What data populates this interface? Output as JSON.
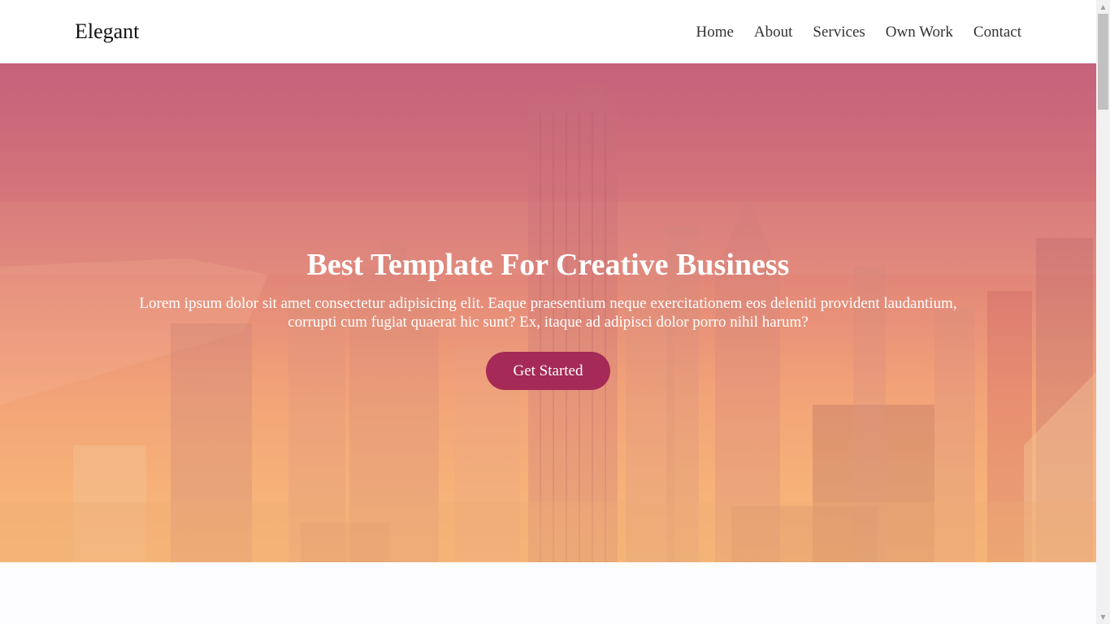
{
  "header": {
    "brand": "Elegant",
    "nav": [
      {
        "label": "Home"
      },
      {
        "label": "About"
      },
      {
        "label": "Services"
      },
      {
        "label": "Own Work"
      },
      {
        "label": "Contact"
      }
    ]
  },
  "hero": {
    "title": "Best Template For Creative Business",
    "text": "Lorem ipsum dolor sit amet consectetur adipisicing elit. Eaque praesentium neque exercitationem eos deleniti provident laudantium, corrupti cum fugiat quaerat hic sunt? Ex, itaque ad adipisci dolor porro nihil harum?",
    "cta_label": "Get Started",
    "background": "city-skyline-image"
  },
  "colors": {
    "accent": "#a52a57",
    "gradient_top": "#c4627b",
    "gradient_bottom": "#f7ba79"
  },
  "icons": {
    "scroll_up": "triangle-up-icon",
    "scroll_down": "triangle-down-icon"
  }
}
